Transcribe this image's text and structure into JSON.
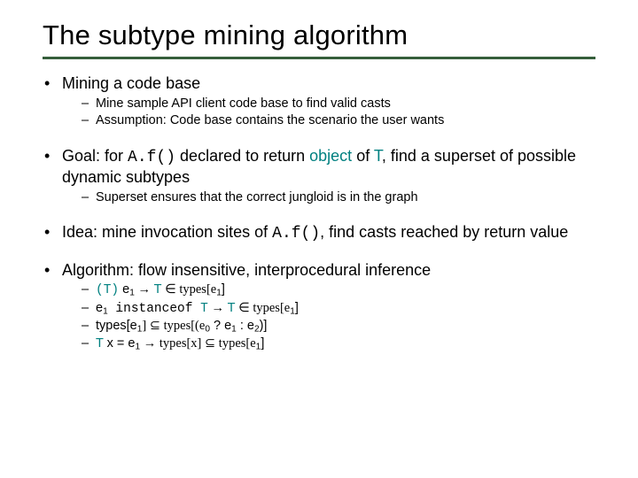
{
  "title": "The subtype mining algorithm",
  "bullets": [
    {
      "text": "Mining a code base",
      "sub": [
        "Mine sample API client code base to find valid casts",
        "Assumption: Code base contains the scenario the user wants"
      ]
    },
    {
      "parts": {
        "p1": "Goal: for ",
        "code1": "A.f()",
        "p2": " declared to return ",
        "obj": "object",
        "p3": " of ",
        "t": "T",
        "p4": ", find a superset of possible dynamic subtypes"
      },
      "sub": [
        "Superset ensures that the correct jungloid is in the graph"
      ]
    },
    {
      "parts": {
        "p1": "Idea: mine invocation sites of ",
        "code1": "A.f()",
        "p2": ", find casts reached by return value"
      }
    },
    {
      "text": "Algorithm: flow insensitive, interprocedural inference",
      "rules": {
        "r1": {
          "a": "(T)",
          "b": " e",
          "s1": "1",
          "c": " → ",
          "d": "T",
          "e": " ∈ types[e",
          "s2": "1",
          "f": "]"
        },
        "r2": {
          "a": "e",
          "s1": "1",
          "b": " instanceof ",
          "c": "T",
          "d": " → ",
          "e": "T",
          "f": " ∈ types[e",
          "s2": "1",
          "g": "]"
        },
        "r3": {
          "a": "types[e",
          "s1": "1",
          "b": "] ⊆ types[(e",
          "s2": "0",
          "c": " ? e",
          "s3": "1",
          "d": " : e",
          "s4": "2",
          "e": ")]"
        },
        "r4": {
          "a": "T",
          "b": " x = e",
          "s1": "1",
          "c": " → types[x] ⊆ types[e",
          "s2": "1",
          "d": "]"
        }
      }
    }
  ]
}
